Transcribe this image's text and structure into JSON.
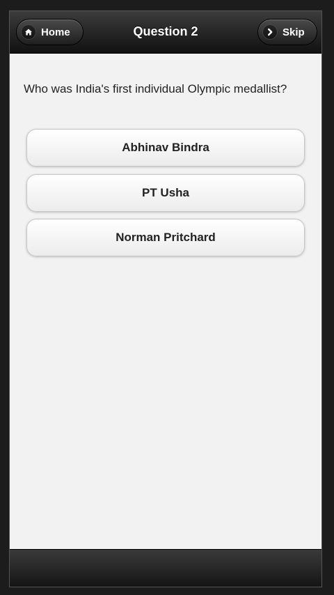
{
  "header": {
    "title": "Question 2",
    "home_label": "Home",
    "skip_label": "Skip",
    "home_icon": "home-icon",
    "skip_icon": "chevron-right-icon"
  },
  "question": {
    "text": "Who was India's first individual Olympic medallist?"
  },
  "answers": [
    {
      "label": "Abhinav Bindra"
    },
    {
      "label": "PT Usha"
    },
    {
      "label": "Norman Pritchard"
    }
  ],
  "colors": {
    "header_background": "#1a1a1a",
    "content_background": "#f2f2f2",
    "button_text": "#222222"
  }
}
